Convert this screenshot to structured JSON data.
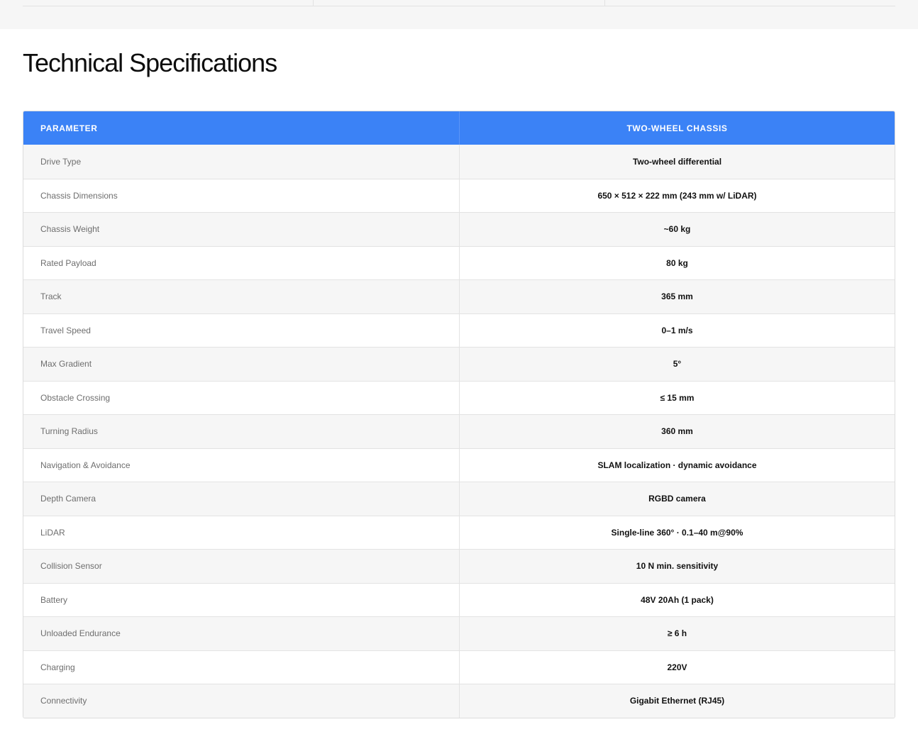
{
  "page": {
    "title": "Technical Specifications"
  },
  "colors": {
    "header_bg": "#3b82f6",
    "header_text": "#ffffff",
    "row_alt_bg": "#f6f6f6"
  },
  "table": {
    "headers": {
      "parameter": "PARAMETER",
      "value": "TWO-WHEEL CHASSIS"
    },
    "rows": [
      {
        "parameter": "Drive Type",
        "value": "Two-wheel differential"
      },
      {
        "parameter": "Chassis Dimensions",
        "value": "650 × 512 × 222 mm (243 mm w/ LiDAR)"
      },
      {
        "parameter": "Chassis Weight",
        "value": "~60 kg"
      },
      {
        "parameter": "Rated Payload",
        "value": "80 kg"
      },
      {
        "parameter": "Track",
        "value": "365 mm"
      },
      {
        "parameter": "Travel Speed",
        "value": "0–1 m/s"
      },
      {
        "parameter": "Max Gradient",
        "value": "5°"
      },
      {
        "parameter": "Obstacle Crossing",
        "value": "≤ 15 mm"
      },
      {
        "parameter": "Turning Radius",
        "value": "360 mm"
      },
      {
        "parameter": "Navigation & Avoidance",
        "value": "SLAM localization · dynamic avoidance"
      },
      {
        "parameter": "Depth Camera",
        "value": "RGBD camera"
      },
      {
        "parameter": "LiDAR",
        "value": "Single-line 360° · 0.1–40 m@90%"
      },
      {
        "parameter": "Collision Sensor",
        "value": "10 N min. sensitivity"
      },
      {
        "parameter": "Battery",
        "value": "48V 20Ah (1 pack)"
      },
      {
        "parameter": "Unloaded Endurance",
        "value": "≥ 6 h"
      },
      {
        "parameter": "Charging",
        "value": "220V"
      },
      {
        "parameter": "Connectivity",
        "value": "Gigabit Ethernet (RJ45)"
      }
    ]
  }
}
